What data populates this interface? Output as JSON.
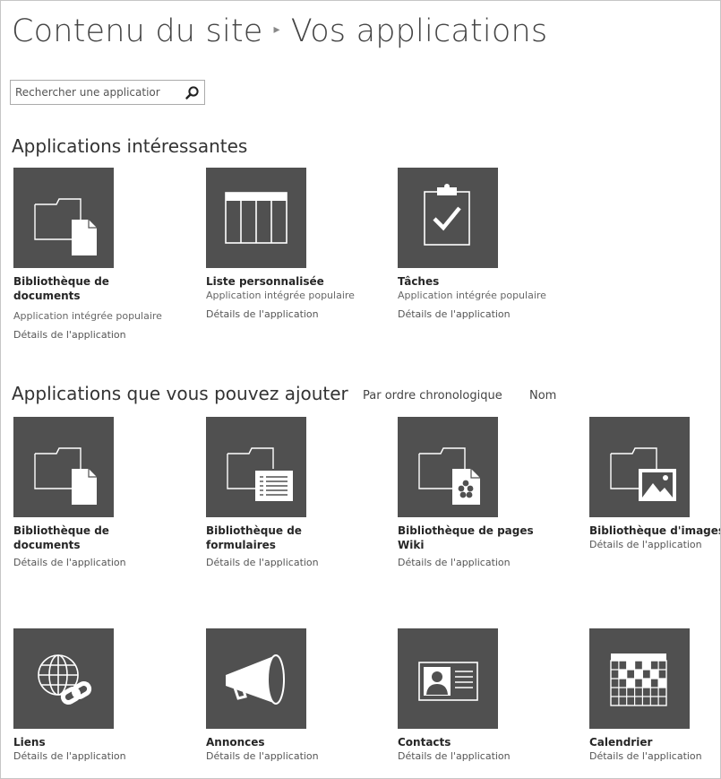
{
  "header": {
    "breadcrumb_root": "Contenu du site",
    "breadcrumb_current": "Vos applications"
  },
  "search": {
    "placeholder": "Rechercher une applicatior",
    "value": ""
  },
  "noteworthy": {
    "title": "Applications intéressantes",
    "apps": [
      {
        "name_line1": "Bibliothèque de",
        "name_line2": "documents",
        "subtitle": "Application intégrée populaire",
        "details": "Détails de l'application",
        "icon": "document-library-icon"
      },
      {
        "name_line1": "Liste personnalisée",
        "name_line2": "",
        "subtitle": "Application intégrée populaire",
        "details": "Détails de l'application",
        "icon": "custom-list-icon"
      },
      {
        "name_line1": "Tâches",
        "name_line2": "",
        "subtitle": "Application intégrée populaire",
        "details": "Détails de l'application",
        "icon": "tasks-icon"
      }
    ]
  },
  "addable": {
    "title": "Applications que vous pouvez ajouter",
    "sort_newest": "Par ordre chronologique",
    "sort_name": "Nom",
    "apps": [
      {
        "name_line1": "Bibliothèque de",
        "name_line2": "documents",
        "details": "Détails de l'application",
        "icon": "document-library-icon"
      },
      {
        "name_line1": "Bibliothèque de",
        "name_line2": "formulaires",
        "details": "Détails de l'application",
        "icon": "form-library-icon"
      },
      {
        "name_line1": "Bibliothèque de pages",
        "name_line2": "Wiki",
        "details": "Détails de l'application",
        "icon": "wiki-page-library-icon"
      },
      {
        "name_line1": "Bibliothèque d'images",
        "name_line2": "",
        "details": "Détails de l'application",
        "icon": "picture-library-icon"
      },
      {
        "name_line1": "Liens",
        "name_line2": "",
        "details": "Détails de l'application",
        "icon": "links-icon"
      },
      {
        "name_line1": "Annonces",
        "name_line2": "",
        "details": "Détails de l'application",
        "icon": "announcements-icon"
      },
      {
        "name_line1": "Contacts",
        "name_line2": "",
        "details": "Détails de l'application",
        "icon": "contacts-icon"
      },
      {
        "name_line1": "Calendrier",
        "name_line2": "",
        "details": "Détails de l'application",
        "icon": "calendar-icon"
      }
    ]
  },
  "colors": {
    "tile_bg": "#505050",
    "icon_fg": "#ffffff",
    "text": "#444444"
  }
}
